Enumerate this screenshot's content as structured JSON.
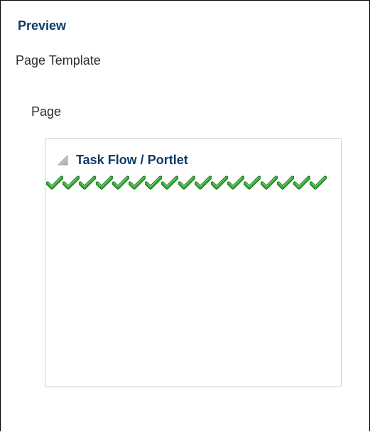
{
  "preview": {
    "title": "Preview",
    "template_label": "Page Template",
    "page_label": "Page"
  },
  "portlet": {
    "title": "Task Flow / Portlet",
    "collapse_icon": "triangle-collapse-icon",
    "check_icon": "green-checkmark-icon",
    "check_count": 17
  },
  "colors": {
    "heading_blue": "#0b3a6b",
    "text_dark": "#2b2b2b",
    "panel_border": "#c5ccd3",
    "check_green": "#2fa62f"
  }
}
